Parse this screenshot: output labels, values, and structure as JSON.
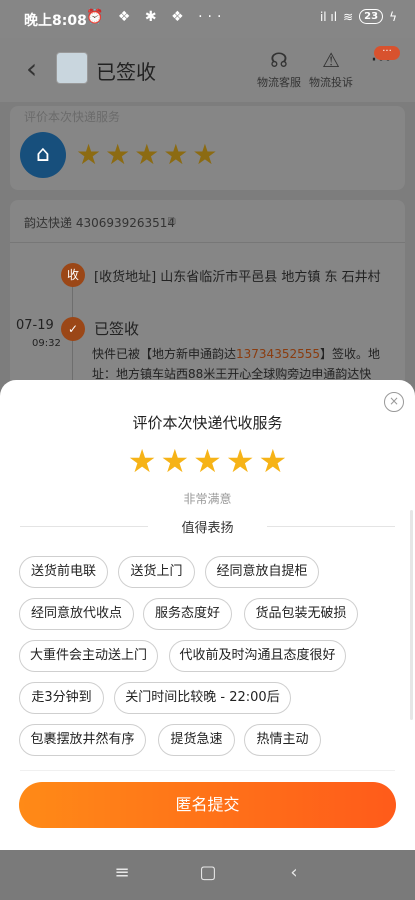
{
  "status_bar": {
    "time": "晚上8:08",
    "left_icons": "⏰ ❖ ✱ ❖ ···",
    "signal_text": "il  ıl",
    "battery": "23",
    "charging": "ϟ"
  },
  "header": {
    "back_icon": "chevron-left-icon",
    "back_glyph": "‹",
    "title": "已签收",
    "actions": [
      {
        "label": "物流客服",
        "icon": "headset-icon",
        "glyph": "☊"
      },
      {
        "label": "物流投诉",
        "icon": "warning-icon",
        "glyph": "⚠"
      }
    ],
    "more_glyph": "···",
    "more_badge": "···"
  },
  "background": {
    "rating_faded_label": "评价本次快递服务",
    "store_glyph": "⌂",
    "bg_stars": "★★★★★",
    "tracking_label": "韵达快递 4306939263514",
    "copy_glyph": "⧉",
    "node_received": "收",
    "node_check": "✓",
    "address": "[收货地址] 山东省临沂市平邑县 地方镇 东 石井村",
    "date": "07-19",
    "time": "09:32",
    "signed_title": "已签收",
    "detail_before": "快件已被【地方新申通韵达",
    "detail_phone": "13734352555",
    "detail_after": "】签收。地址：地方镇车站西88米王开心全球购旁边申通韵达快"
  },
  "sheet": {
    "close_glyph": "×",
    "title": "评价本次快递代收服务",
    "star_glyph": "★",
    "rating": 5,
    "rating_max": 5,
    "rating_text": "非常满意",
    "praise_label": "值得表扬",
    "tags": [
      "送货前电联",
      "送货上门",
      "经同意放自提柜",
      "经同意放代收点",
      "服务态度好",
      "货品包装无破损",
      "大重件会主动送上门",
      "代收前及时沟通且态度很好",
      "走3分钟到",
      "关门时间比较晚 - 22:00后",
      "包裹摆放井然有序",
      "提货急速",
      "热情主动"
    ],
    "submit_label": "匿名提交"
  },
  "navbar": {
    "menu_glyph": "≡",
    "home_glyph": "▢",
    "back_glyph": "‹"
  },
  "colors": {
    "accent": "#ff6a1a",
    "star": "#f6b317"
  }
}
